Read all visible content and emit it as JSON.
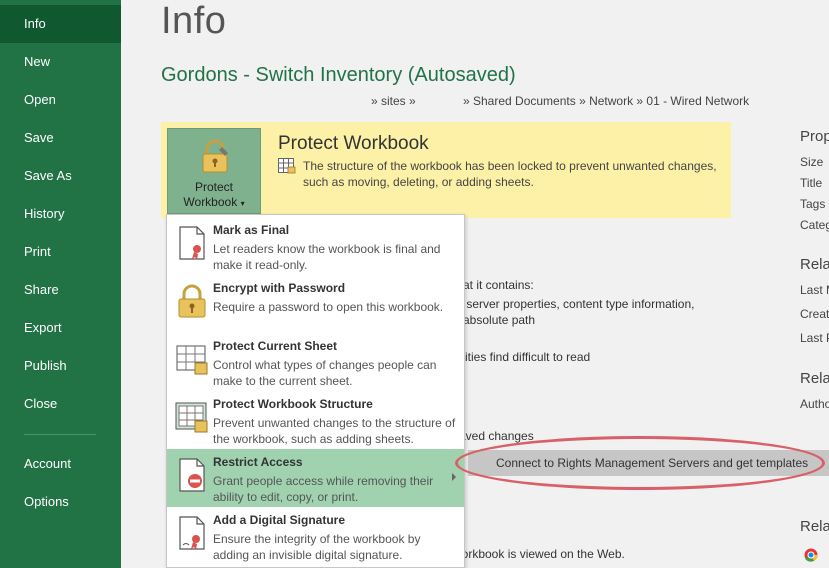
{
  "nav": {
    "items": [
      "Info",
      "New",
      "Open",
      "Save",
      "Save As",
      "History",
      "Print",
      "Share",
      "Export",
      "Publish",
      "Close"
    ],
    "bottom_items": [
      "Account",
      "Options"
    ]
  },
  "page": {
    "title": "Info",
    "doc_title": "Gordons - Switch Inventory (Autosaved)",
    "path": [
      "» sites »",
      "» Shared Documents » Network » 01 - Wired Network"
    ]
  },
  "protect": {
    "button_label_1": "Protect",
    "button_label_2": "Workbook",
    "heading": "Protect Workbook",
    "description": "The structure of the workbook has been locked to prevent unwanted changes, such as moving, deleting, or adding sheets."
  },
  "menu": {
    "items": [
      {
        "title": "Mark as Final",
        "desc": "Let readers know the workbook is final and make it read-only."
      },
      {
        "title": "Encrypt with Password",
        "desc": "Require a password to open this workbook."
      },
      {
        "title": "Protect Current Sheet",
        "desc": "Control what types of changes people can make to the current sheet."
      },
      {
        "title": "Protect Workbook Structure",
        "desc": "Prevent unwanted changes to the structure of the workbook, such as adding sheets."
      },
      {
        "title": "Restrict Access",
        "desc": "Grant people access while removing their ability to edit, copy, or print."
      },
      {
        "title": "Add a Digital Signature",
        "desc": "Ensure the integrity of the workbook by adding an invisible digital signature."
      }
    ]
  },
  "submenu": {
    "label": "Connect to Rights Management Servers and get templates"
  },
  "background_text": {
    "line1": "that it contains:",
    "line2": "nt server properties, content type information,",
    "line3": "d absolute path",
    "line4": "bilities find difficult to read",
    "line5": "saved changes",
    "line6": "workbook is viewed on the Web."
  },
  "properties": {
    "head1": "Prop",
    "size": "Size",
    "title": "Title",
    "tags": "Tags",
    "categories": "Categ",
    "head2": "Rela",
    "last_modified": "Last M",
    "created": "Creat",
    "last_printed": "Last P",
    "head3": "Rela",
    "author": "Autho",
    "head4": "Rela"
  },
  "colors": {
    "sidebar": "#217346",
    "sidebar_active": "#10582f",
    "protect_band": "#fcf1a6",
    "selected_item": "#a0d2b0",
    "annotation": "#d96068"
  }
}
